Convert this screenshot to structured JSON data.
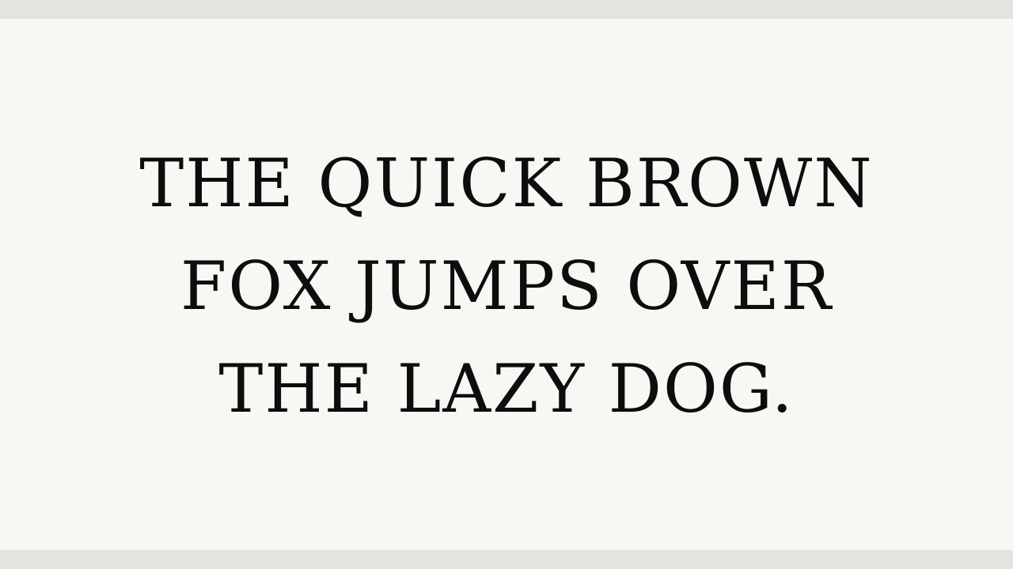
{
  "specimen": {
    "lines": [
      "THE QUICK BROWN",
      "FOX JUMPS OVER",
      "THE LAZY DOG."
    ]
  },
  "colors": {
    "background": "#f8f7f3",
    "band": "#e4e3df",
    "text": "#0d0d0d"
  }
}
